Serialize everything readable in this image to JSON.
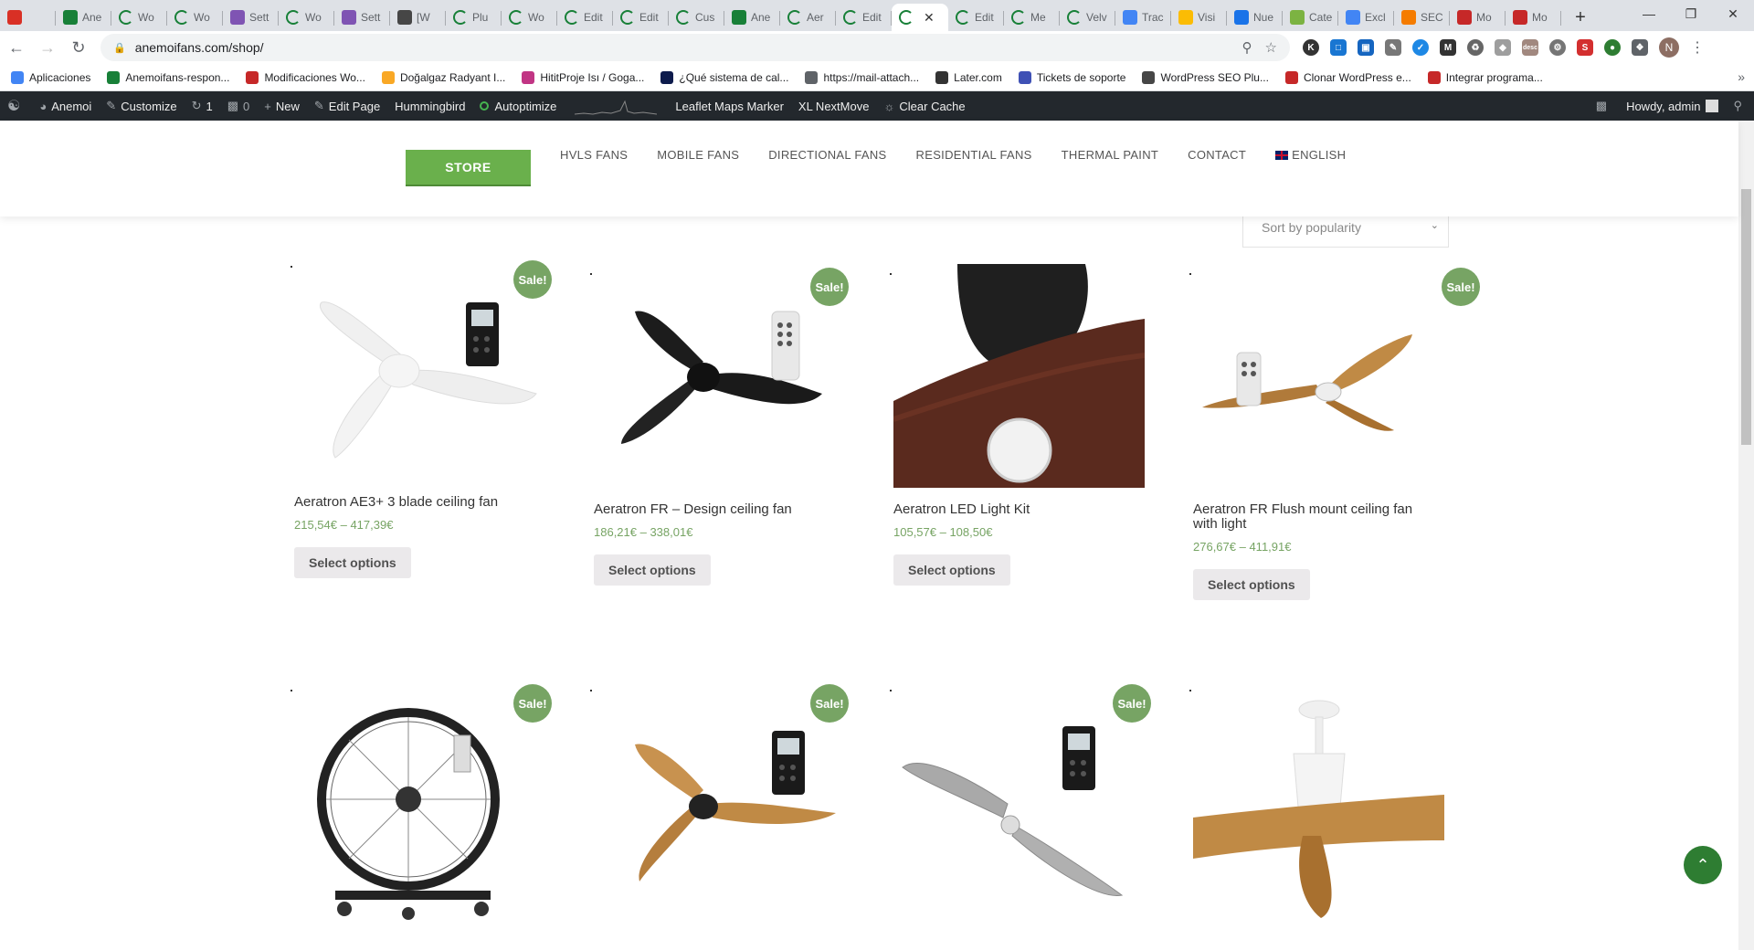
{
  "browser": {
    "tabs": [
      {
        "label": "",
        "icon": "gmail-icon",
        "color": "#d93025"
      },
      {
        "label": "Ane",
        "icon": "sheets-icon",
        "color": "#188038"
      },
      {
        "label": "Wo",
        "icon": "loading-icon",
        "color": "#188038"
      },
      {
        "label": "Wo",
        "icon": "loading-icon",
        "color": "#188038"
      },
      {
        "label": "Sett",
        "icon": "woo-icon",
        "color": "#7f54b3"
      },
      {
        "label": "Wo",
        "icon": "loading-icon",
        "color": "#188038"
      },
      {
        "label": "Sett",
        "icon": "woo-icon",
        "color": "#7f54b3"
      },
      {
        "label": "[W",
        "icon": "wordpress-icon",
        "color": "#464646"
      },
      {
        "label": "Plu",
        "icon": "loading-icon",
        "color": "#188038"
      },
      {
        "label": "Wo",
        "icon": "loading-icon",
        "color": "#188038"
      },
      {
        "label": "Edit",
        "icon": "loading-icon",
        "color": "#188038"
      },
      {
        "label": "Edit",
        "icon": "loading-icon",
        "color": "#188038"
      },
      {
        "label": "Cus",
        "icon": "loading-icon",
        "color": "#188038"
      },
      {
        "label": "Ane",
        "icon": "sheets-icon",
        "color": "#188038"
      },
      {
        "label": "Aer",
        "icon": "loading-icon",
        "color": "#188038"
      },
      {
        "label": "Edit",
        "icon": "loading-icon",
        "color": "#188038"
      },
      {
        "label": "",
        "icon": "loading-icon",
        "color": "#188038",
        "active": true
      },
      {
        "label": "Edit",
        "icon": "loading-icon",
        "color": "#188038"
      },
      {
        "label": "Me",
        "icon": "loading-icon",
        "color": "#188038"
      },
      {
        "label": "Velv",
        "icon": "loading-icon",
        "color": "#188038"
      },
      {
        "label": "Trac",
        "icon": "translate-icon",
        "color": "#4285f4"
      },
      {
        "label": "Visi",
        "icon": "ads-icon",
        "color": "#fbbc04"
      },
      {
        "label": "Nue",
        "icon": "doc-icon",
        "color": "#1a73e8"
      },
      {
        "label": "Cate",
        "icon": "plant-icon",
        "color": "#7cb342"
      },
      {
        "label": "Excl",
        "icon": "google-icon",
        "color": "#4285f4"
      },
      {
        "label": "SEC",
        "icon": "seo-icon",
        "color": "#f57c00"
      },
      {
        "label": "Mo",
        "icon": "plugin-icon",
        "color": "#c62828"
      },
      {
        "label": "Mo",
        "icon": "plugin-icon",
        "color": "#c62828"
      }
    ],
    "close_tab_glyph": "✕",
    "new_tab_glyph": "+",
    "url": "anemoifans.com/shop/",
    "profile_initial": "N",
    "extension_badge": "desc",
    "bookmarks": [
      {
        "label": "Aplicaciones",
        "icon": "apps-icon",
        "color": "#4285f4"
      },
      {
        "label": "Anemoifans-respon...",
        "icon": "sheets-icon",
        "color": "#188038"
      },
      {
        "label": "Modificaciones Wo...",
        "icon": "plugin-icon",
        "color": "#c62828"
      },
      {
        "label": "Doğalgaz Radyant I...",
        "icon": "flame-icon",
        "color": "#f9a825"
      },
      {
        "label": "HititProje Isı / Goga...",
        "icon": "instagram-icon",
        "color": "#c13584"
      },
      {
        "label": "¿Qué sistema de cal...",
        "icon": "news-icon",
        "color": "#0d1b4c"
      },
      {
        "label": "https://mail-attach...",
        "icon": "globe-icon",
        "color": "#5f6368"
      },
      {
        "label": "Later.com",
        "icon": "later-icon",
        "color": "#333333"
      },
      {
        "label": "Tickets de soporte",
        "icon": "ticket-icon",
        "color": "#3f51b5"
      },
      {
        "label": "WordPress SEO Plu...",
        "icon": "wordpress-icon",
        "color": "#464646"
      },
      {
        "label": "Clonar WordPress e...",
        "icon": "plugin-icon",
        "color": "#c62828"
      },
      {
        "label": "Integrar programa...",
        "icon": "plugin-icon",
        "color": "#c62828"
      }
    ],
    "bookmarks_more": "»"
  },
  "adminbar": {
    "site_name": "Anemoi",
    "customize": "Customize",
    "updates_count": "1",
    "comments_count": "0",
    "new_label": "New",
    "edit_page": "Edit Page",
    "hummingbird": "Hummingbird",
    "autoptimize": "Autoptimize",
    "leaflet": "Leaflet Maps Marker",
    "nextmove": "XL NextMove",
    "clear_cache": "Clear Cache",
    "howdy": "Howdy, admin"
  },
  "site": {
    "store_label": "STORE",
    "nav": [
      "HVLS FANS",
      "MOBILE FANS",
      "DIRECTIONAL FANS",
      "RESIDENTIAL FANS",
      "THERMAL PAINT",
      "CONTACT"
    ],
    "language": "ENGLISH",
    "sort_label": "Sort by popularity",
    "sale_badge": "Sale!",
    "products": [
      {
        "title": "Aeratron AE3+ 3 blade ceiling fan",
        "price": "215,54€ – 417,39€",
        "button": "Select options",
        "sale": true
      },
      {
        "title": "Aeratron FR – Design ceiling fan",
        "price": "186,21€ – 338,01€",
        "button": "Select options",
        "sale": true
      },
      {
        "title": "Aeratron LED Light Kit",
        "price": "105,57€ – 108,50€",
        "button": "Select options",
        "sale": false
      },
      {
        "title": "Aeratron FR Flush mount ceiling fan with light",
        "price": "276,67€ – 411,91€",
        "button": "Select options",
        "sale": true
      },
      {
        "title": "",
        "price": "",
        "button": "",
        "sale": true
      },
      {
        "title": "",
        "price": "",
        "button": "",
        "sale": true
      },
      {
        "title": "",
        "price": "",
        "button": "",
        "sale": true
      },
      {
        "title": "",
        "price": "",
        "button": "",
        "sale": false
      }
    ]
  }
}
